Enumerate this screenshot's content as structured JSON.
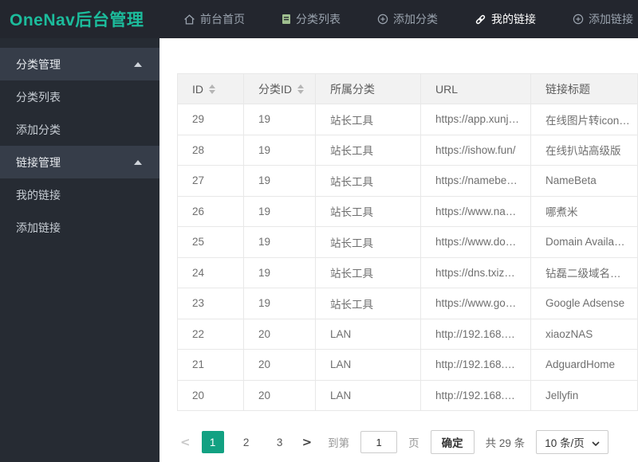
{
  "topbar": {
    "logo": "OneNav后台管理",
    "nav": [
      {
        "id": "home",
        "label": "前台首页",
        "icon": "home-icon",
        "active": false
      },
      {
        "id": "category-list",
        "label": "分类列表",
        "icon": "file-icon",
        "active": false
      },
      {
        "id": "add-category",
        "label": "添加分类",
        "icon": "plus-circle-icon",
        "active": false
      },
      {
        "id": "my-links",
        "label": "我的链接",
        "icon": "link-icon",
        "active": true
      },
      {
        "id": "add-links",
        "label": "添加链接",
        "icon": "plus-circle-icon",
        "active": false
      }
    ]
  },
  "sidebar": {
    "sections": [
      {
        "id": "category-manage",
        "label": "分类管理",
        "expanded": true,
        "items": [
          {
            "id": "category-list",
            "label": "分类列表"
          },
          {
            "id": "add-category",
            "label": "添加分类"
          }
        ]
      },
      {
        "id": "link-manage",
        "label": "链接管理",
        "expanded": true,
        "items": [
          {
            "id": "my-links",
            "label": "我的链接"
          },
          {
            "id": "add-links",
            "label": "添加链接"
          }
        ]
      }
    ]
  },
  "table": {
    "columns": [
      {
        "label": "ID",
        "sortable": true
      },
      {
        "label": "分类ID",
        "sortable": true
      },
      {
        "label": "所属分类",
        "sortable": false
      },
      {
        "label": "URL",
        "sortable": false
      },
      {
        "label": "链接标题",
        "sortable": false
      }
    ],
    "rows": [
      [
        "29",
        "19",
        "站长工具",
        "https://app.xunj…",
        "在线图片转icon…"
      ],
      [
        "28",
        "19",
        "站长工具",
        "https://ishow.fun/",
        "在线扒站高级版"
      ],
      [
        "27",
        "19",
        "站长工具",
        "https://namebe…",
        "NameBeta"
      ],
      [
        "26",
        "19",
        "站长工具",
        "https://www.na…",
        "哪煮米"
      ],
      [
        "25",
        "19",
        "站长工具",
        "https://www.do…",
        "Domain Availa…"
      ],
      [
        "24",
        "19",
        "站长工具",
        "https://dns.txiz…",
        "钻磊二级域名…"
      ],
      [
        "23",
        "19",
        "站长工具",
        "https://www.go…",
        "Google Adsense"
      ],
      [
        "22",
        "20",
        "LAN",
        "http://192.168.…",
        "xiaozNAS"
      ],
      [
        "21",
        "20",
        "LAN",
        "http://192.168.…",
        "AdguardHome"
      ],
      [
        "20",
        "20",
        "LAN",
        "http://192.168.…",
        "Jellyfin"
      ]
    ]
  },
  "pagination": {
    "prev": "<",
    "next": ">",
    "pages": [
      "1",
      "2",
      "3"
    ],
    "active_page": "1",
    "goto_label": "到第",
    "goto_value": "1",
    "page_unit": "页",
    "confirm_label": "确定",
    "total_label": "共 29 条",
    "page_size_label": "10 条/页"
  },
  "colors": {
    "accent": "#1cbc9c",
    "active_page_bg": "#12a182",
    "topbar_bg": "#23262e",
    "sidebar_bg": "#262b33",
    "sidebar_header_bg": "#363d49"
  }
}
